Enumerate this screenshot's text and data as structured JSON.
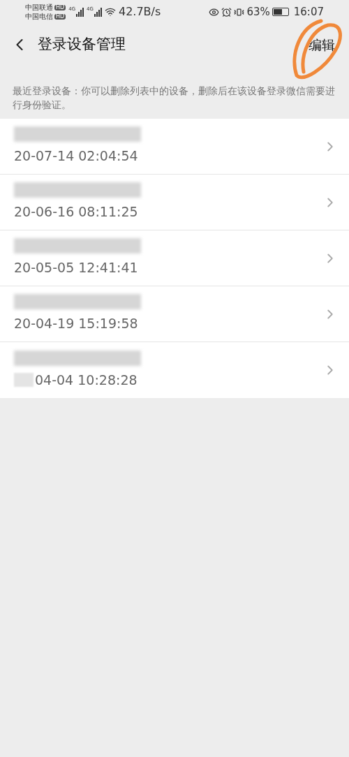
{
  "status_bar": {
    "carriers": [
      {
        "name": "中国联通",
        "badge": "HD"
      },
      {
        "name": "中国电信",
        "badge": "HD"
      }
    ],
    "network": [
      "4G",
      "4G"
    ],
    "speed": "42.7B/s",
    "battery_text": "63%",
    "time": "16:07"
  },
  "header": {
    "title": "登录设备管理",
    "action": "编辑"
  },
  "notice": "最近登录设备：你可以删除列表中的设备，删除后在该设备登录微信需要进行身份验证。",
  "devices": [
    {
      "time": "20-07-14 02:04:54",
      "date_redacted": false
    },
    {
      "time": "20-06-16 08:11:25",
      "date_redacted": false
    },
    {
      "time": "20-05-05 12:41:41",
      "date_redacted": false
    },
    {
      "time": "20-04-19 15:19:58",
      "date_redacted": false
    },
    {
      "time": "04-04 10:28:28",
      "date_redacted": true
    }
  ]
}
